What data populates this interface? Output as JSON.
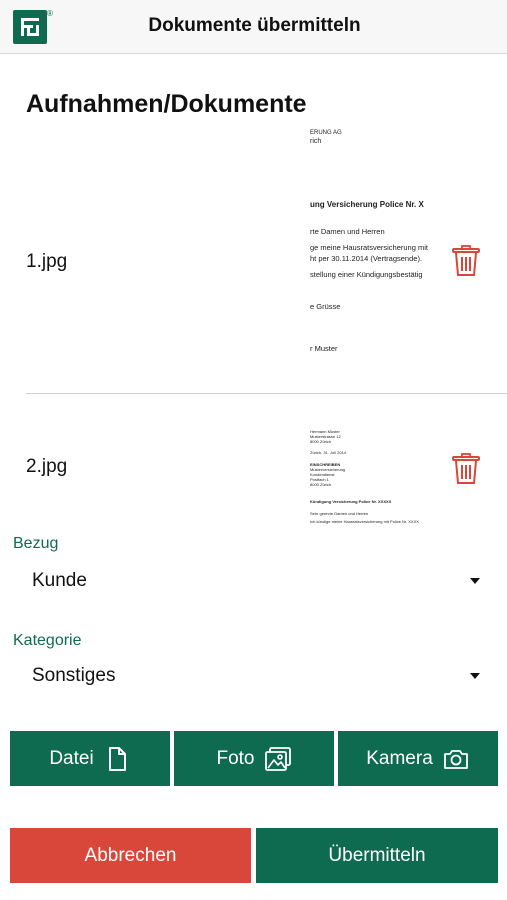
{
  "header": {
    "title": "Dokumente übermitteln",
    "logo_mark": "®",
    "logo_icon": "app-logo-icon",
    "background": "#f7f7f7"
  },
  "section": {
    "title": "Aufnahmen/Dokumente"
  },
  "documents": [
    {
      "name": "1.jpg",
      "delete_icon": "trash-icon",
      "thumbnail_lines": [
        "ERUNG AG",
        "rich",
        "ung Versicherung Police Nr. X",
        "rte Damen und Herren",
        "ge meine Hausratsversicherung mit",
        "ht per 30.11.2014 (Vertragsende).",
        "stellung einer Kündigungsbestätig",
        "e Grüsse",
        "r Muster"
      ]
    },
    {
      "name": "2.jpg",
      "delete_icon": "trash-icon",
      "thumbnail_lines": [
        "Hermann Muster",
        "Musterstrasse 12",
        "8000 Zürich",
        "Zürich, 31. Juli 2014",
        "EINSCHREIBEN",
        "Musterversicherung",
        "Kundendienst",
        "Postfach 1",
        "8000 Zürich",
        "Kündigung Versicherung Police Nr. XXXXX",
        "Sehr geehrte Damen und Herren",
        "Ich kündige meine Hausratsversicherung mit Police Nr. XXXX"
      ]
    }
  ],
  "bezug": {
    "label": "Bezug",
    "value": "Kunde"
  },
  "kategorie": {
    "label": "Kategorie",
    "value": "Sonstiges"
  },
  "source_buttons": {
    "datei": "Datei",
    "foto": "Foto",
    "kamera": "Kamera"
  },
  "actions": {
    "cancel": "Abbrechen",
    "submit": "Übermitteln"
  },
  "colors": {
    "brand_green": "#0f6b4f",
    "danger_red": "#d9473b",
    "trash_icon": "#d9473b"
  }
}
